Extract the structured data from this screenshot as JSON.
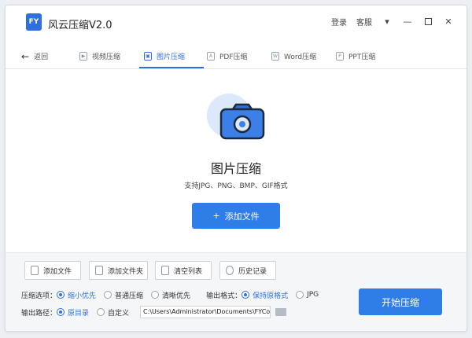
{
  "app": {
    "logo_text": "FY",
    "title": "风云压缩V2.0"
  },
  "titlebar": {
    "login": "登录",
    "service": "客服",
    "menu_icon": "dropdown-icon",
    "minimize_icon": "minimize-icon",
    "maximize_icon": "maximize-icon",
    "close_icon": "close-icon"
  },
  "nav": {
    "back": "返回",
    "tabs": [
      {
        "label": "视频压缩",
        "active": false
      },
      {
        "label": "图片压缩",
        "active": true
      },
      {
        "label": "PDF压缩",
        "active": false
      },
      {
        "label": "Word压缩",
        "active": false
      },
      {
        "label": "PPT压缩",
        "active": false
      }
    ]
  },
  "main": {
    "title": "图片压缩",
    "subtitle": "支持JPG、PNG、BMP、GIF格式",
    "add_button": "添加文件",
    "accent_color": "#2f7ee8"
  },
  "toolbar": {
    "add_file": "添加文件",
    "add_folder": "添加文件夹",
    "clear_list": "清空列表",
    "history": "历史记录"
  },
  "options": {
    "compress_label": "压缩选项：",
    "compress_opts": [
      "缩小优先",
      "普通压缩",
      "清晰优先"
    ],
    "compress_selected": 0,
    "format_label": "输出格式：",
    "format_opts": [
      "保持原格式",
      "JPG"
    ],
    "format_selected": 0,
    "path_label": "输出路径：",
    "path_opts": [
      "原目录",
      "自定义"
    ],
    "path_selected": 0,
    "path_value": "C:\\Users\\Administrator\\Documents\\FYCom"
  },
  "start_button": "开始压缩"
}
